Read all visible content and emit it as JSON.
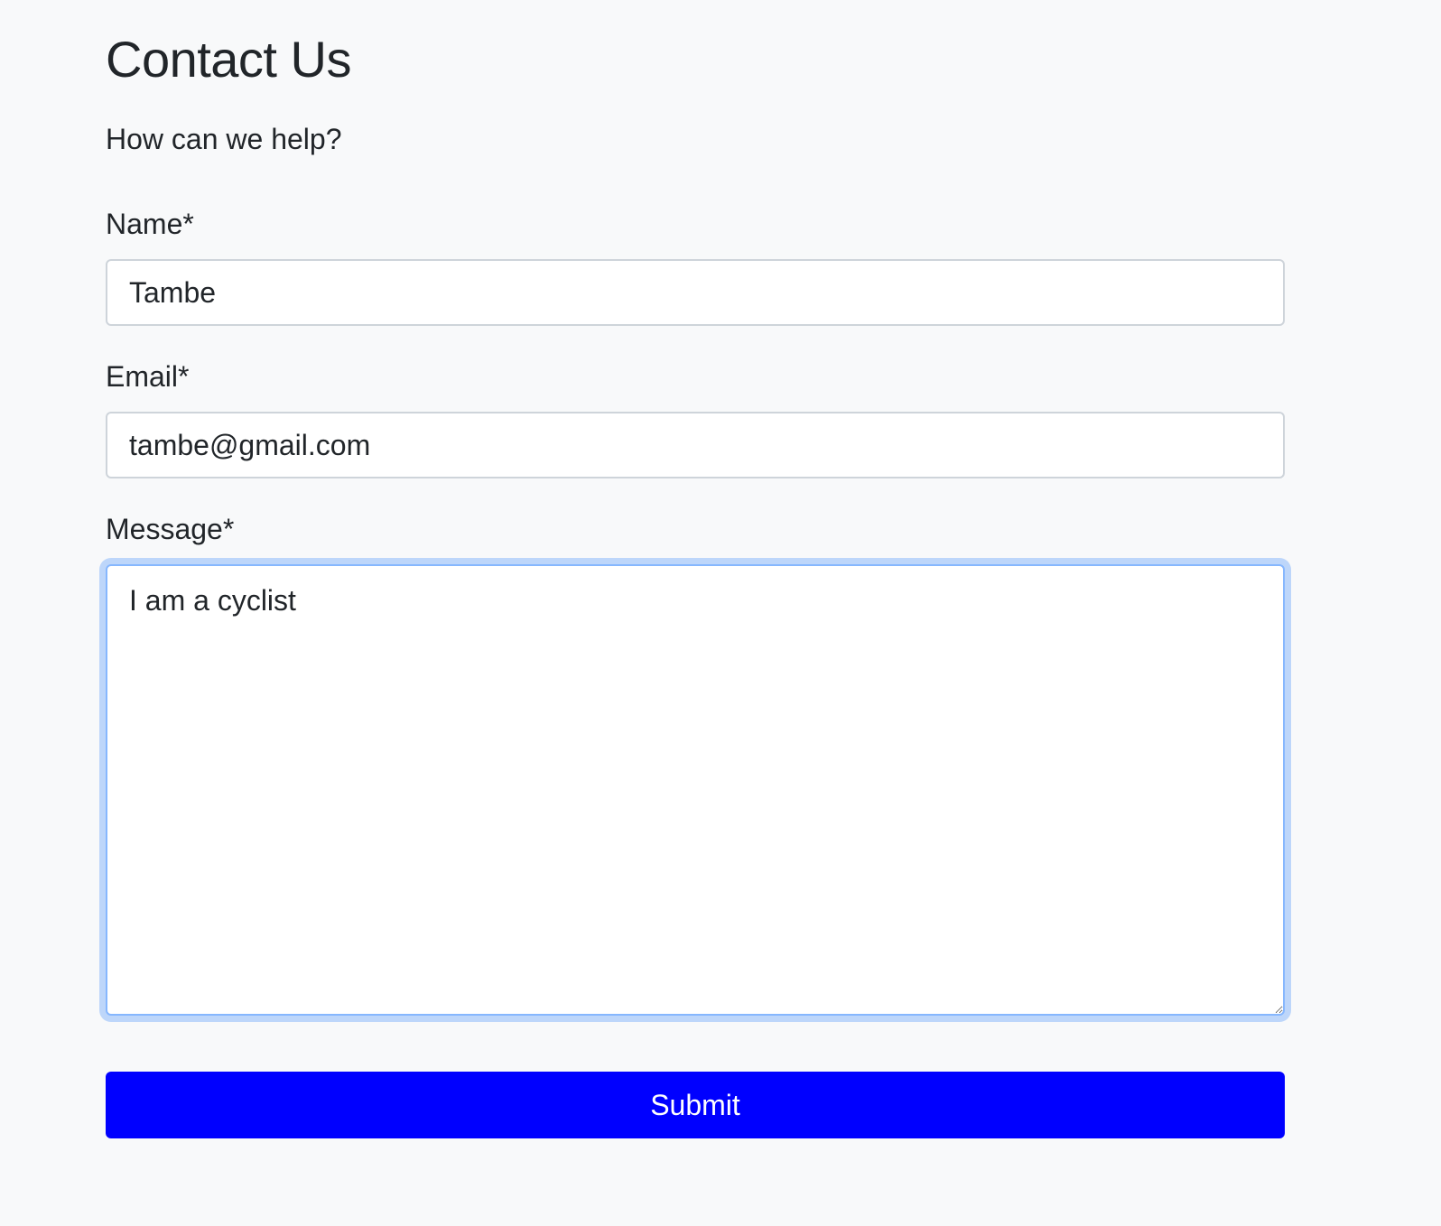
{
  "page": {
    "title": "Contact Us",
    "subtitle": "How can we help?"
  },
  "form": {
    "name": {
      "label": "Name*",
      "value": "Tambe"
    },
    "email": {
      "label": "Email*",
      "value": "tambe@gmail.com"
    },
    "message": {
      "label": "Message*",
      "value": "I am a cyclist"
    },
    "submit_label": "Submit"
  },
  "colors": {
    "background": "#f8f9fa",
    "text": "#212529",
    "submit_button": "#0000ff",
    "focus_ring": "#86b7fe"
  }
}
